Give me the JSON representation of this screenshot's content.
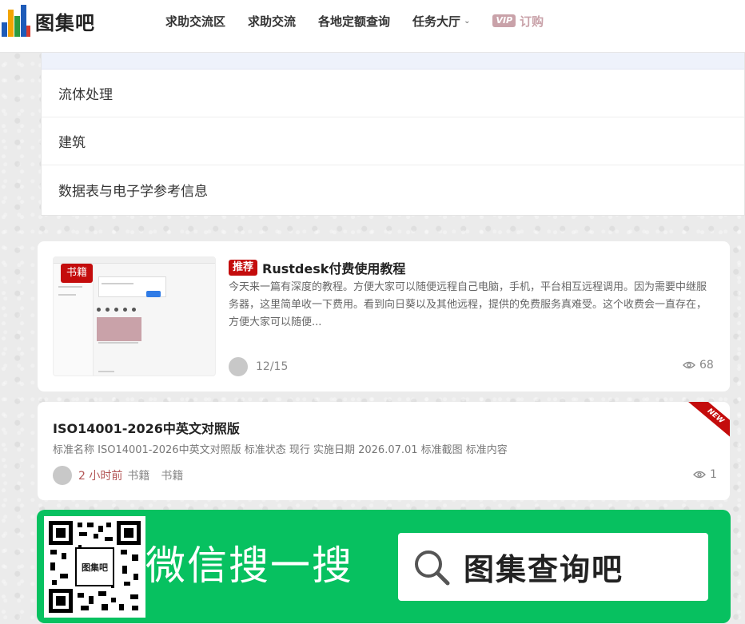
{
  "header": {
    "logo_text": "图集吧",
    "nav": [
      {
        "label": "求助交流区"
      },
      {
        "label": "求助交流"
      },
      {
        "label": "各地定额查询"
      },
      {
        "label": "任务大厅"
      }
    ],
    "vip_badge": "VIP",
    "vip_label": "订购"
  },
  "categories": [
    {
      "label": "流体处理"
    },
    {
      "label": "建筑"
    },
    {
      "label": "数据表与电子学参考信息"
    }
  ],
  "post1": {
    "thumb_tag": "书籍",
    "badge": "推荐",
    "title": "Rustdesk付费使用教程",
    "description": "今天来一篇有深度的教程。方便大家可以随便远程自己电脑，手机，平台相互远程调用。因为需要中继服务器，这里简单收一下费用。看到向日葵以及其他远程，提供的免费服务真难受。这个收费会一直存在，方便大家可以随便...",
    "date": "12/15",
    "views": "68"
  },
  "post2": {
    "ribbon": "NEW",
    "title": "ISO14001-2026中英文对照版",
    "description": "标准名称 ISO14001-2026中英文对照版 标准状态 现行 实施日期 2026.07.01 标准截图 标准内容",
    "time": "2 小时前",
    "category": "书籍",
    "category2": "书籍",
    "views": "1"
  },
  "wechat_banner": {
    "slogan": "微信搜一搜",
    "search_text": "图集查询吧",
    "qr_logo_text": "图集吧"
  },
  "colors": {
    "brand_red": "#c40c0c",
    "vip_pink": "#c9a2a9",
    "wechat_green": "#07c160"
  }
}
